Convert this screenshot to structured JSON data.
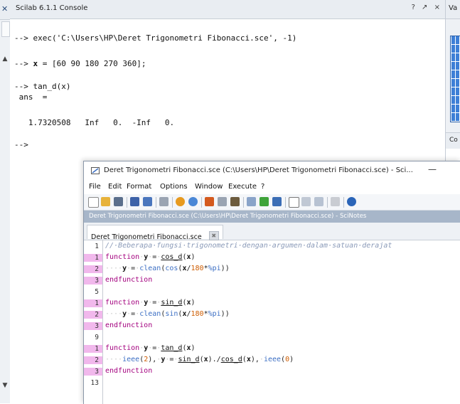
{
  "console": {
    "title": "Scilab 6.1.1 Console",
    "controls": "? ↗ ×",
    "lines": [
      {
        "text": "--> exec('C:\\Users\\HP\\Deret Trigonometri Fibonacci.sce', -1)"
      },
      {
        "text": "--> x = [60 90 180 270 360];"
      },
      {
        "text": "--> tan_d(x)"
      },
      {
        "text": " ans  ="
      },
      {
        "text": "   1.7320508   Inf   0.  -Inf   0."
      },
      {
        "text": "-->"
      }
    ]
  },
  "right_panel": {
    "title": "Va",
    "lower_title": "Co"
  },
  "scinotes": {
    "window_title": "Deret Trigonometri Fibonacci.sce (C:\\Users\\HP\\Deret Trigonometri Fibonacci.sce) - Sci...",
    "minimize": "—",
    "menu": [
      "File",
      "Edit",
      "Format",
      "Options",
      "Window",
      "Execute",
      "?"
    ],
    "path_bar": "Deret Trigonometri Fibonacci.sce (C:\\Users\\HP\\Deret Trigonometri Fibonacci.sce) - SciNotes",
    "tab_label": "Deret Trigonometri Fibonacci.sce",
    "tab_close": "✖",
    "toolbar_icons": [
      "new-file-icon",
      "open-file-icon",
      "open-folder-icon",
      "save-icon",
      "save-as-icon",
      "print-icon",
      "undo-icon",
      "redo-icon",
      "cut-icon",
      "copy-icon",
      "paste-icon",
      "find-icon",
      "execute-file-icon",
      "execute-echo-icon",
      "run-icon",
      "run-selection-icon",
      "tools-icon",
      "preferences-icon",
      "help-icon"
    ],
    "gutter": [
      "1",
      "1",
      "2",
      "3",
      "5",
      "1",
      "2",
      "3",
      "9",
      "1",
      "2",
      "3",
      "13"
    ],
    "gutter_highlight": [
      false,
      true,
      true,
      true,
      false,
      true,
      true,
      true,
      false,
      true,
      true,
      true,
      false
    ],
    "code": {
      "l1": "//·Beberapa·fungsi·trigonometri·dengan·argumen·dalam·satuan·derajat",
      "kw_function": "function",
      "kw_endfunction": "endfunction",
      "y": "y",
      "x": "x",
      "eq": "=",
      "cos_d": "cos_d",
      "sin_d": "sin_d",
      "tan_d": "tan_d",
      "clean": "clean",
      "cos": "cos",
      "sin": "sin",
      "ieee": "ieee",
      "pi": "%pi",
      "n180": "180",
      "n2": "2",
      "n0": "0"
    }
  }
}
